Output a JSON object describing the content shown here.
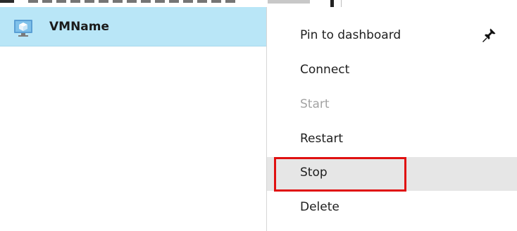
{
  "vm": {
    "name": "VMName",
    "icon": "virtual-machine-icon"
  },
  "context_menu": {
    "items": [
      {
        "label": "Pin to dashboard",
        "icon": "pin-icon",
        "enabled": true
      },
      {
        "label": "Connect",
        "enabled": true
      },
      {
        "label": "Start",
        "enabled": false
      },
      {
        "label": "Restart",
        "enabled": true
      },
      {
        "label": "Stop",
        "enabled": true,
        "hovered": true,
        "highlighted": true
      },
      {
        "label": "Delete",
        "enabled": true
      }
    ]
  },
  "colors": {
    "selected_row_bg": "#b9e6f7",
    "hover_bg": "#e6e6e6",
    "disabled_text": "#a3a3a3",
    "highlight_border": "#e01010"
  }
}
